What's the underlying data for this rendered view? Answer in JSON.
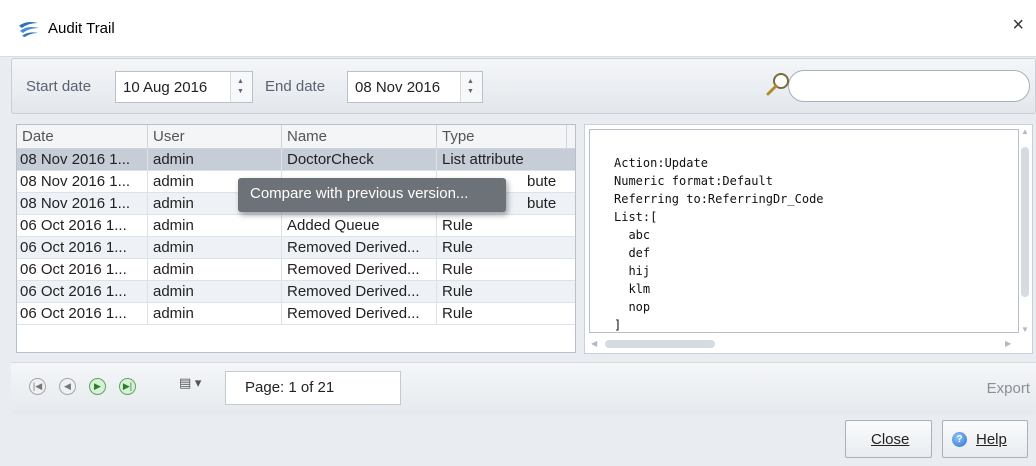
{
  "window": {
    "title": "Audit Trail",
    "close_glyph": "×"
  },
  "filters": {
    "start_label": "Start date",
    "start_value": "10 Aug 2016",
    "end_label": "End date",
    "end_value": "08 Nov 2016",
    "search_icon": "magnifier-icon",
    "search_value": ""
  },
  "grid": {
    "columns": [
      "Date",
      "User",
      "Name",
      "Type"
    ],
    "rows": [
      {
        "date": "08 Nov 2016 1...",
        "user": "admin",
        "name": "DoctorCheck",
        "type": "List attribute",
        "selected": true
      },
      {
        "date": "08 Nov 2016 1...",
        "user": "admin",
        "name": "",
        "type": "bute"
      },
      {
        "date": "08 Nov 2016 1...",
        "user": "admin",
        "name": "",
        "type": "bute"
      },
      {
        "date": "06 Oct 2016 1...",
        "user": "admin",
        "name": "Added Queue",
        "type": "Rule"
      },
      {
        "date": "06 Oct 2016 1...",
        "user": "admin",
        "name": "Removed Derived...",
        "type": "Rule"
      },
      {
        "date": "06 Oct 2016 1...",
        "user": "admin",
        "name": "Removed Derived...",
        "type": "Rule"
      },
      {
        "date": "06 Oct 2016 1...",
        "user": "admin",
        "name": "Removed Derived...",
        "type": "Rule"
      },
      {
        "date": "06 Oct 2016 1...",
        "user": "admin",
        "name": "Removed Derived...",
        "type": "Rule"
      }
    ]
  },
  "context_menu": {
    "item": "Compare with previous version..."
  },
  "detail": {
    "text": "Action:Update\nNumeric format:Default\nReferring to:ReferringDr_Code\nList:[\n  abc\n  def\n  hij\n  klm\n  nop\n]"
  },
  "pager": {
    "page_label": "Page: 1 of 21",
    "export_label": "Export",
    "buttons": [
      "first-page-icon",
      "previous-page-icon",
      "next-page-icon",
      "last-page-icon"
    ]
  },
  "footer": {
    "close_label": "Close",
    "help_label": "Help"
  }
}
